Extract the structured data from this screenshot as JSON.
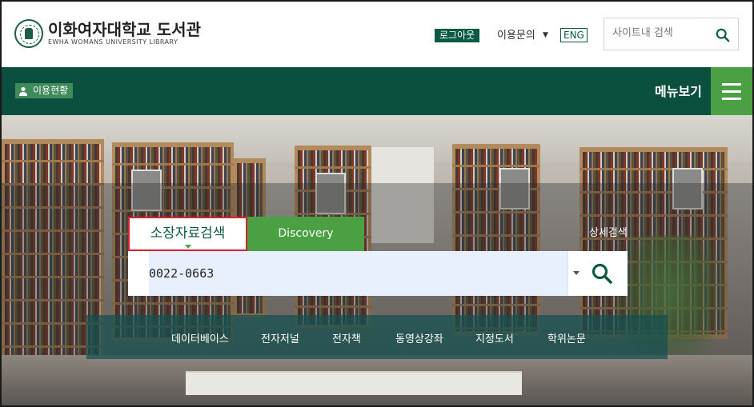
{
  "header": {
    "logo_ko": "이화여자대학교 도서관",
    "logo_en": "EWHA WOMANS UNIVERSITY LIBRARY",
    "logout_label": "로그아웃",
    "inquiry_label": "이용문의",
    "eng_label": "ENG",
    "site_search_placeholder": "사이트내 검색"
  },
  "navbar": {
    "usage_label": "이용현황",
    "menu_label": "메뉴보기"
  },
  "search": {
    "tab_active": "소장자료검색",
    "tab_discovery": "Discovery",
    "advanced_label": "상세검색",
    "query_value": "0022-0663"
  },
  "quick_links": [
    "데이터베이스",
    "전자저널",
    "전자책",
    "동영상강좌",
    "지정도서",
    "학위논문"
  ],
  "colors": {
    "brand_dark_green": "#0b4f3f",
    "accent_green": "#4aa042",
    "active_tab_border": "#d9202e"
  }
}
